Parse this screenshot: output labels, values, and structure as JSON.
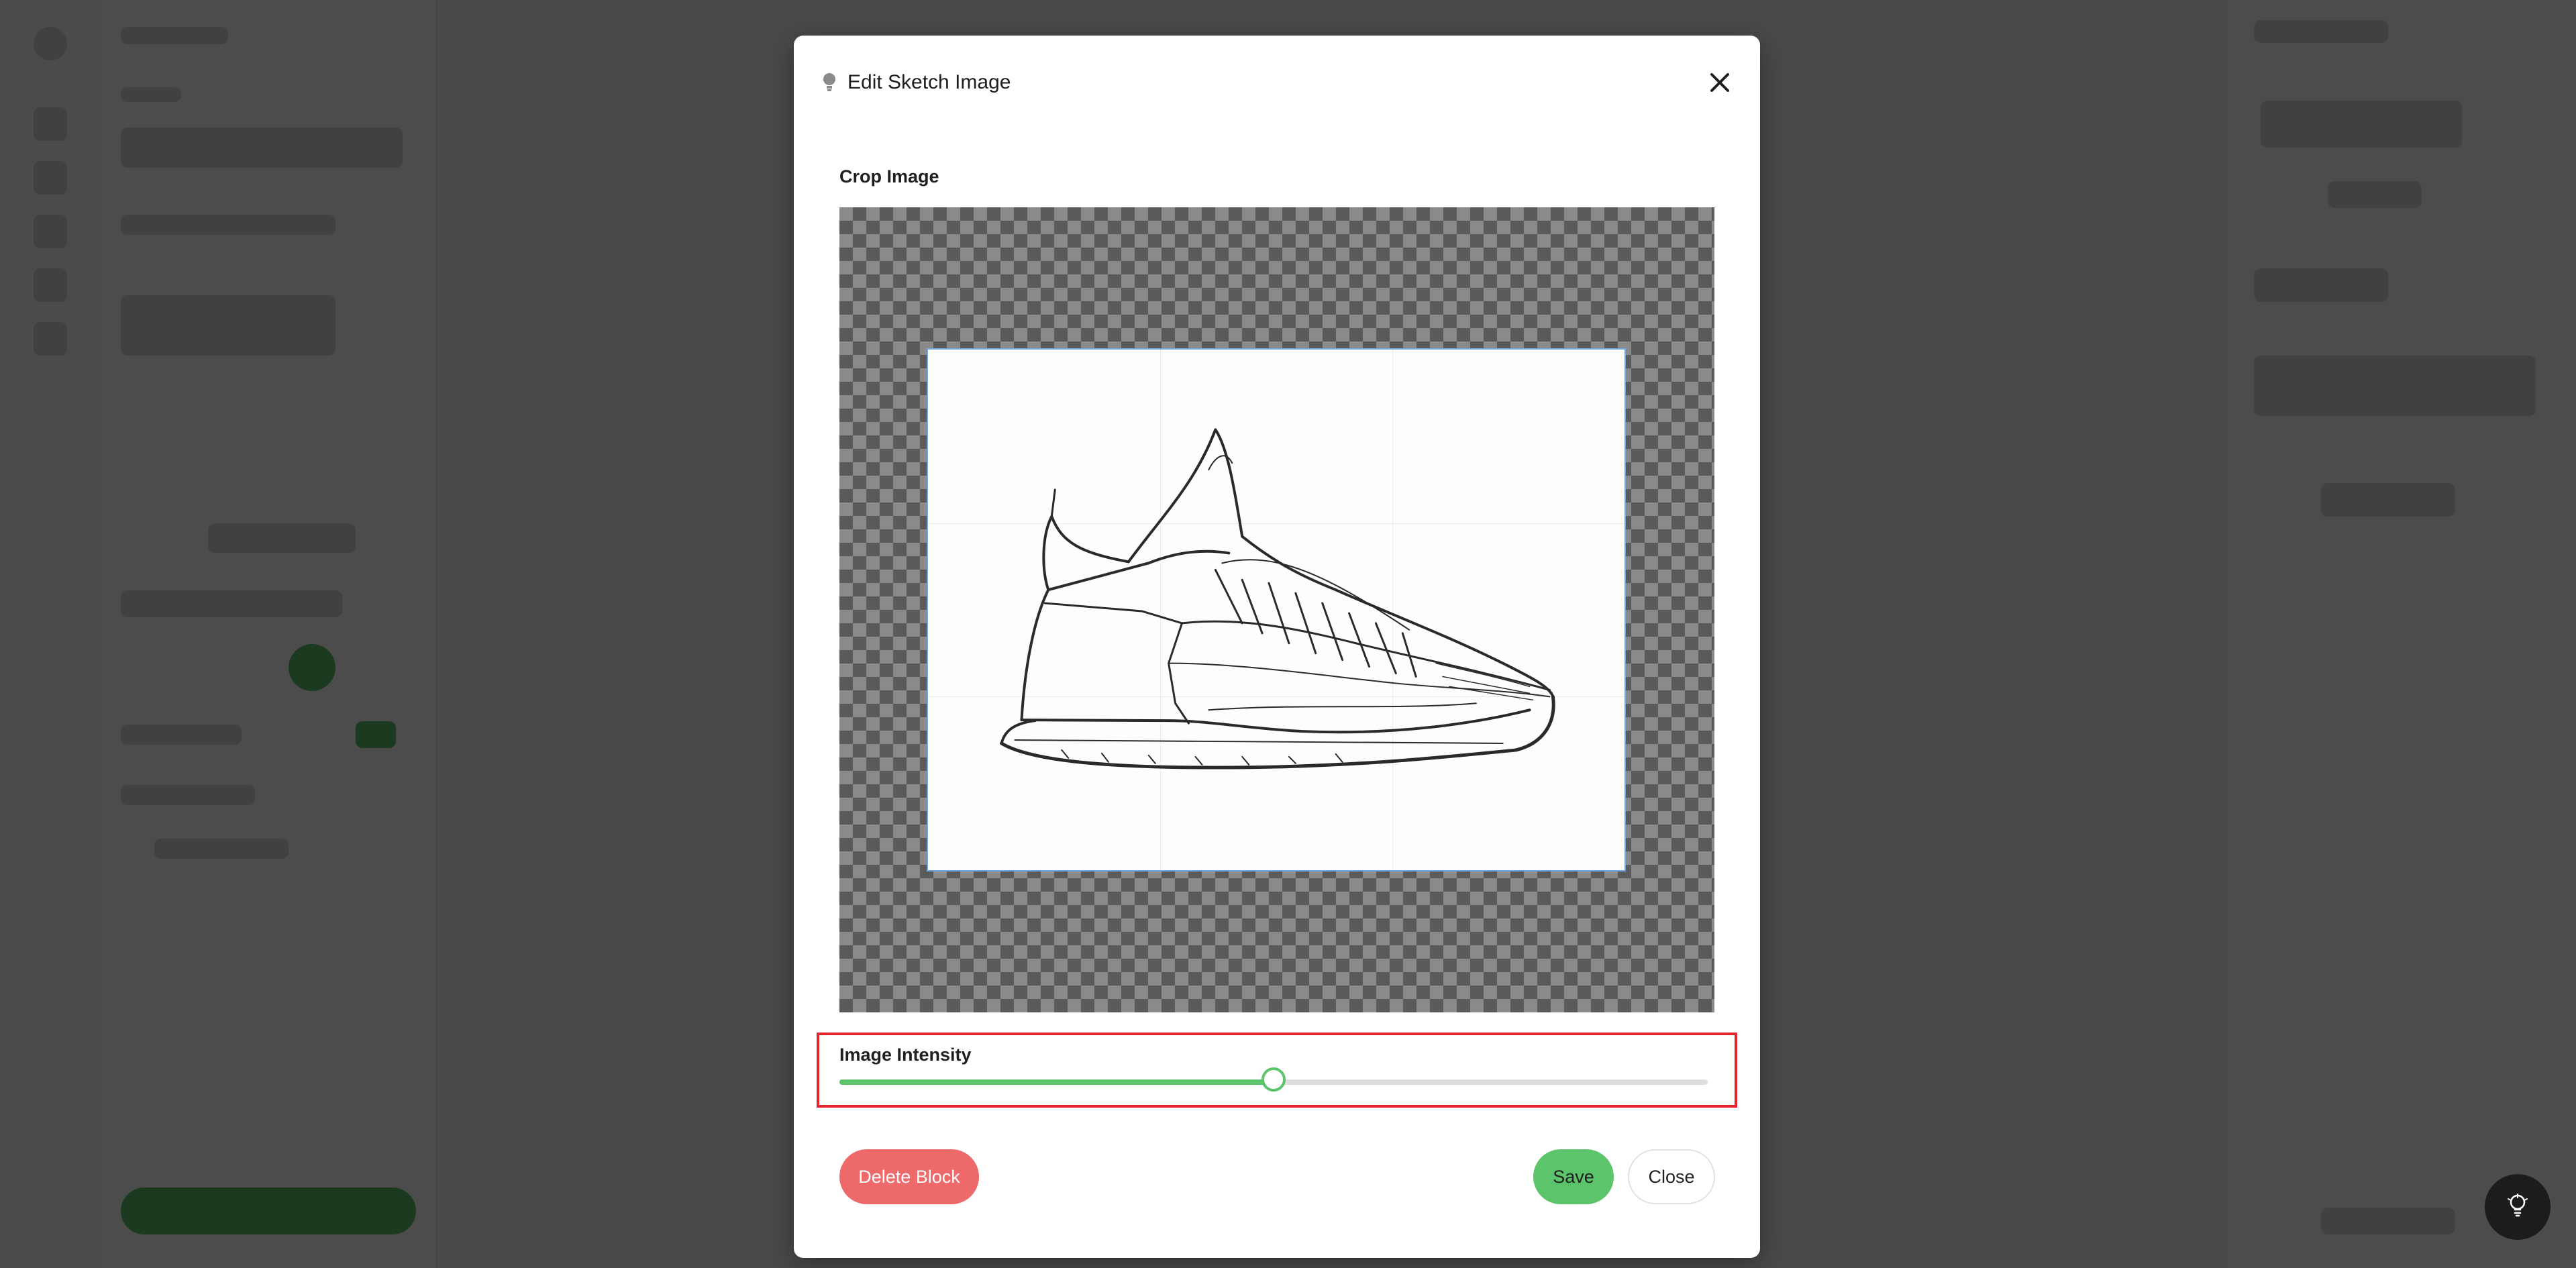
{
  "modal": {
    "title": "Edit Sketch Image",
    "header_icon": "lightbulb-icon",
    "close_icon": "close-icon",
    "crop_label": "Crop Image",
    "intensity_label": "Image Intensity",
    "intensity_value": 0.5,
    "delete_label": "Delete Block",
    "save_label": "Save",
    "close_label": "Close"
  },
  "help_button": {
    "icon": "lightbulb-icon"
  },
  "colors": {
    "accent_green": "#5cc56b",
    "danger_red": "#ee6a6a",
    "highlight_red": "#e3262b",
    "crop_border_blue": "#6fa6e8"
  }
}
